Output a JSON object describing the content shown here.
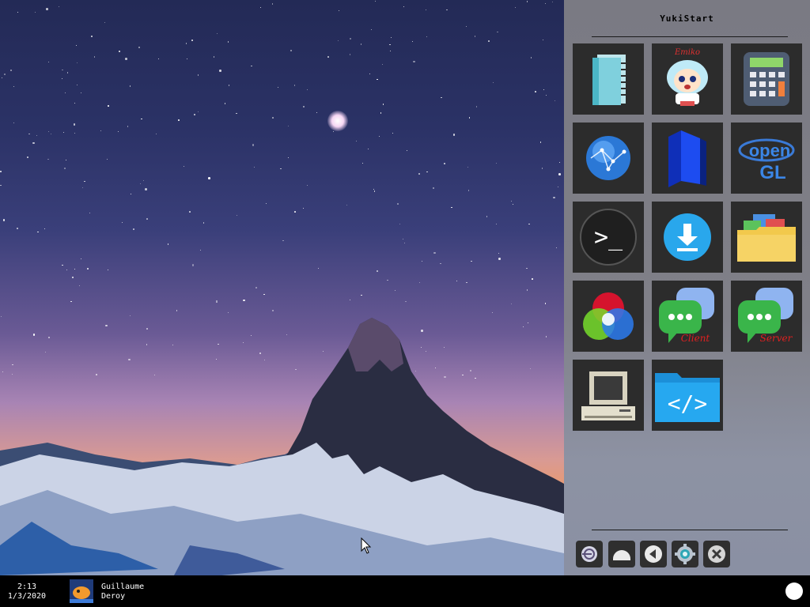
{
  "start_menu": {
    "title": "YukiStart",
    "apps": [
      {
        "name": "notepad",
        "icon": "notebook-icon"
      },
      {
        "name": "emiko",
        "icon": "emiko-mascot-icon",
        "label": "Emiko"
      },
      {
        "name": "calculator",
        "icon": "calculator-icon"
      },
      {
        "name": "web-browser",
        "icon": "globe-icon"
      },
      {
        "name": "file-manager",
        "icon": "blue-folder-icon"
      },
      {
        "name": "opengl",
        "icon": "opengl-logo-icon",
        "label_top": "open",
        "label_bottom": "GL"
      },
      {
        "name": "terminal",
        "icon": "terminal-icon",
        "label": ">_"
      },
      {
        "name": "downloads",
        "icon": "download-icon"
      },
      {
        "name": "folder",
        "icon": "yellow-folder-icon"
      },
      {
        "name": "color-picker",
        "icon": "rgb-circles-icon"
      },
      {
        "name": "chat-client",
        "icon": "chat-bubble-icon",
        "label": "Client"
      },
      {
        "name": "chat-server",
        "icon": "chat-bubble-icon",
        "label": "Server"
      },
      {
        "name": "computer",
        "icon": "retro-computer-icon"
      },
      {
        "name": "code-folder",
        "icon": "code-folder-icon"
      }
    ],
    "bottom_buttons": [
      {
        "name": "logout",
        "icon": "logout-icon"
      },
      {
        "name": "sleep",
        "icon": "half-circle-icon"
      },
      {
        "name": "back",
        "icon": "back-arrow-icon"
      },
      {
        "name": "settings",
        "icon": "gear-icon"
      },
      {
        "name": "close",
        "icon": "close-icon"
      }
    ]
  },
  "taskbar": {
    "time": "2:13",
    "date": "1/3/2020",
    "user_first": "Guillaume",
    "user_last": "Deroy"
  }
}
